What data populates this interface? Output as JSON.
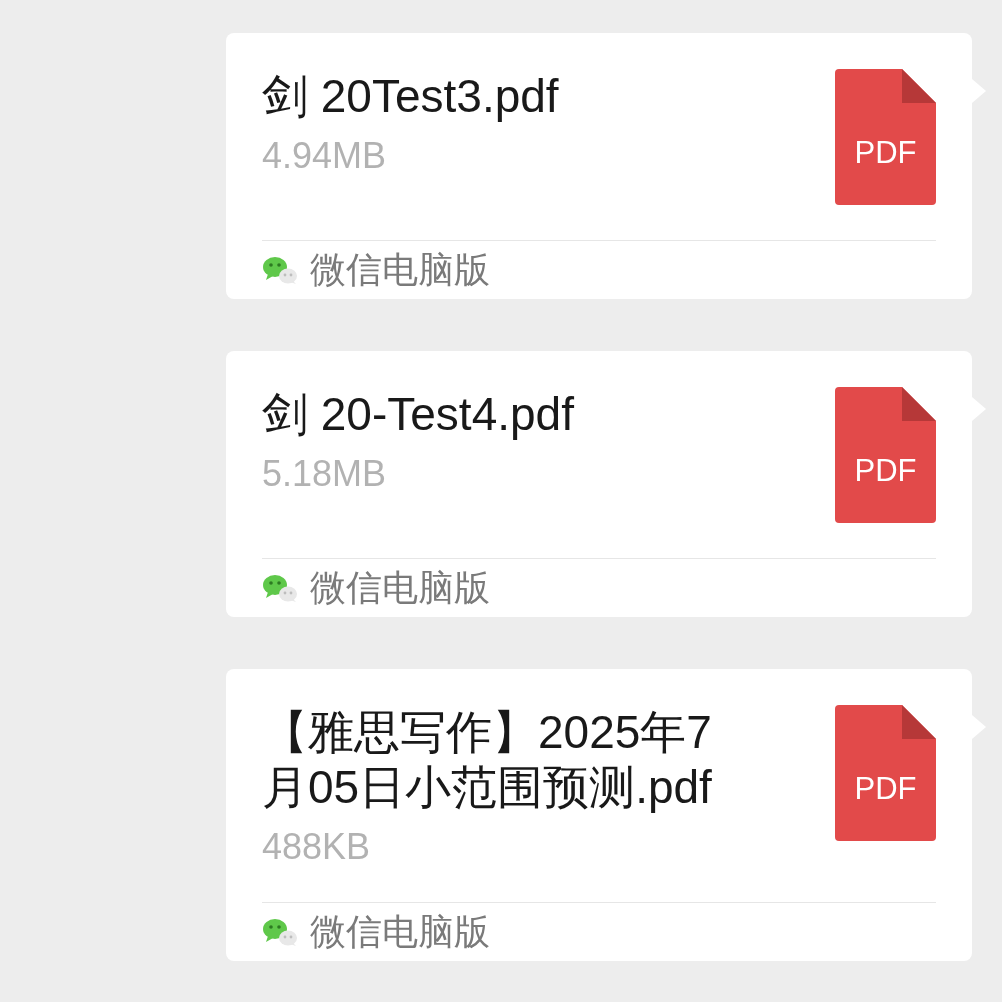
{
  "messages": [
    {
      "file_name": "剑 20Test3.pdf",
      "file_size": "4.94MB",
      "file_type": "PDF",
      "source": "微信电脑版"
    },
    {
      "file_name": "剑 20-Test4.pdf",
      "file_size": "5.18MB",
      "file_type": "PDF",
      "source": "微信电脑版"
    },
    {
      "file_name": "【雅思写作】2025年7月05日小范围预测.pdf",
      "file_size": "488KB",
      "file_type": "PDF",
      "source": "微信电脑版"
    }
  ]
}
